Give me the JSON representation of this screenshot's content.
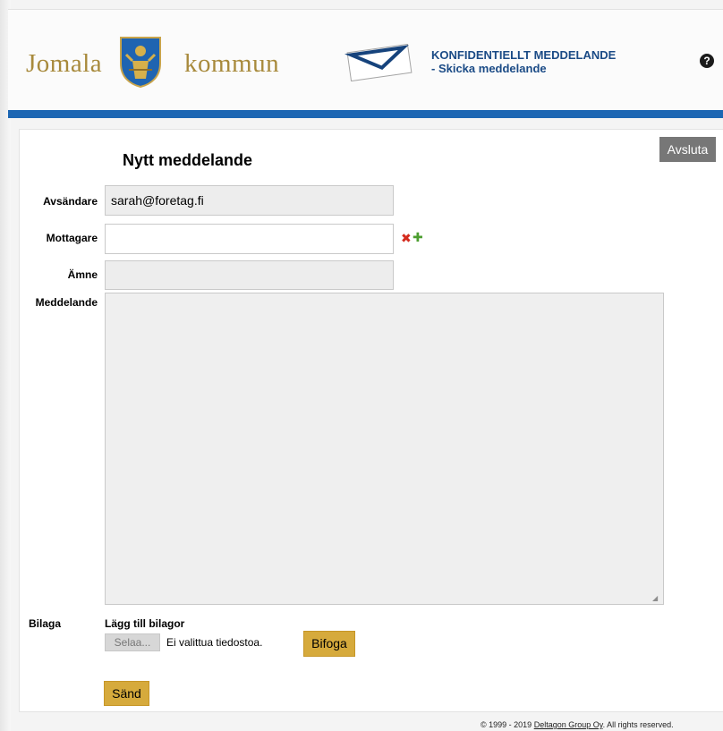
{
  "header": {
    "logo_left": "Jomala",
    "logo_right": "kommun",
    "title_line1": "KONFIDENTIELLT MEDDELANDE",
    "title_line2": "- Skicka meddelande",
    "help_glyph": "?"
  },
  "page": {
    "title": "Nytt meddelande",
    "close_button": "Avsluta"
  },
  "form": {
    "sender_label": "Avsändare",
    "sender_value": "sarah@foretag.fi",
    "recipient_label": "Mottagare",
    "recipient_value": "",
    "subject_label": "Ämne",
    "subject_value": "",
    "message_label": "Meddelande",
    "message_value": ""
  },
  "attachments": {
    "label": "Bilaga",
    "caption": "Lägg till bilagor",
    "browse_button": "Selaa...",
    "file_status": "Ei valittua tiedostoa.",
    "attach_button": "Bifoga"
  },
  "send_button": "Sänd",
  "footer": {
    "copyright": "© 1999 - 2019",
    "link": "Deltagon Group Oy",
    "rights": ". All rights reserved."
  },
  "icons": {
    "remove_recipient": "remove-recipient-icon",
    "add_recipient": "add-recipient-icon",
    "help": "help-icon"
  },
  "colors": {
    "brand_blue": "#1c66b3",
    "title_blue": "#1b4b86",
    "gold_button": "#d6aa3c",
    "gray_button": "#777777",
    "remove_red": "#d42b1e",
    "add_green": "#4c9e2f"
  }
}
